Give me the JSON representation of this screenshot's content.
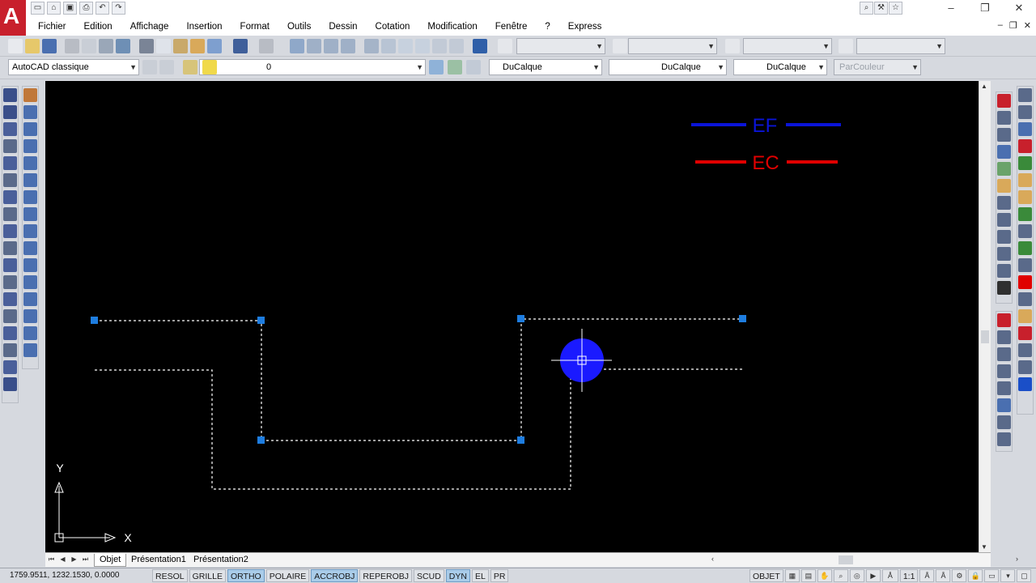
{
  "app": {
    "logo_letter": "A",
    "menu": [
      "Fichier",
      "Edition",
      "Affichage",
      "Insertion",
      "Format",
      "Outils",
      "Dessin",
      "Cotation",
      "Modification",
      "Fenêtre",
      "?",
      "Express"
    ]
  },
  "toolbar": {
    "workspace": "AutoCAD classique",
    "layer": "0",
    "color": "DuCalque",
    "linetype": "DuCalque",
    "lineweight": "DuCalque",
    "plotstyle": "ParCouleur"
  },
  "drawing": {
    "legend": [
      {
        "label": "EF",
        "color": "#0a14d8"
      },
      {
        "label": "EC",
        "color": "#e00000"
      }
    ],
    "ucs": {
      "x_label": "X",
      "y_label": "Y"
    },
    "accent_blue": "#1a1aff",
    "grip_color": "#1e7de0"
  },
  "tabs": [
    "Objet",
    "Présentation1",
    "Présentation2"
  ],
  "status": {
    "coords": "1759.9511, 1232.1530, 0.0000",
    "toggles": [
      {
        "label": "RESOL",
        "on": false
      },
      {
        "label": "GRILLE",
        "on": false
      },
      {
        "label": "ORTHO",
        "on": true
      },
      {
        "label": "POLAIRE",
        "on": false
      },
      {
        "label": "ACCROBJ",
        "on": true
      },
      {
        "label": "REPEROBJ",
        "on": false
      },
      {
        "label": "SCUD",
        "on": false
      },
      {
        "label": "DYN",
        "on": true
      },
      {
        "label": "EL",
        "on": false
      },
      {
        "label": "PR",
        "on": false
      }
    ],
    "objet": "OBJET",
    "scale": "1:1"
  }
}
